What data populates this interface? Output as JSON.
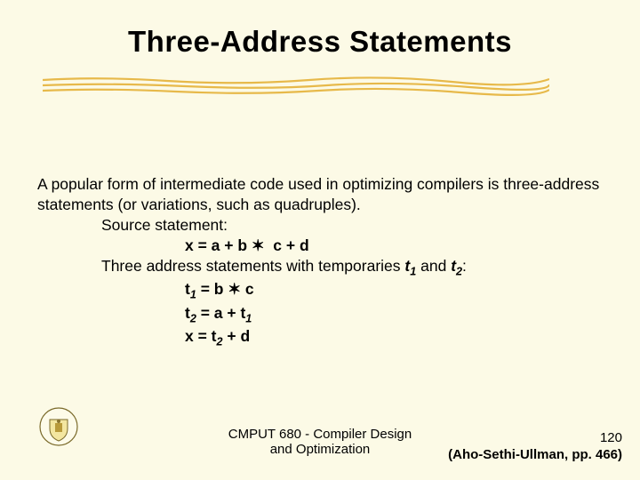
{
  "title": "Three-Address Statements",
  "body": {
    "intro": "A popular form of intermediate code used in optimizing compilers is three-address statements (or variations, such as quadruples).",
    "source_label": "Source statement:",
    "source_eq": "x = a + b ✶  c + d",
    "temps_intro_pre": "Three address statements with temporaries ",
    "t1": "t",
    "t1_sub": "1",
    "temps_and": " and ",
    "t2": "t",
    "t2_sub": "2",
    "temps_colon": ":",
    "eq1_lhs": "t",
    "eq1_sub": "1",
    "eq1_rhs": " = b ✶ c",
    "eq2_lhs": "t",
    "eq2_sub": "2",
    "eq2_rhs_pre": " = a + t",
    "eq2_rhs_sub": "1",
    "eq3_pre": "x = t",
    "eq3_sub": "2",
    "eq3_post": " + d"
  },
  "footer": {
    "course": "CMPUT 680 - Compiler Design\nand Optimization",
    "page": "120",
    "citation": "(Aho-Sethi-Ullman, pp. 466)"
  }
}
